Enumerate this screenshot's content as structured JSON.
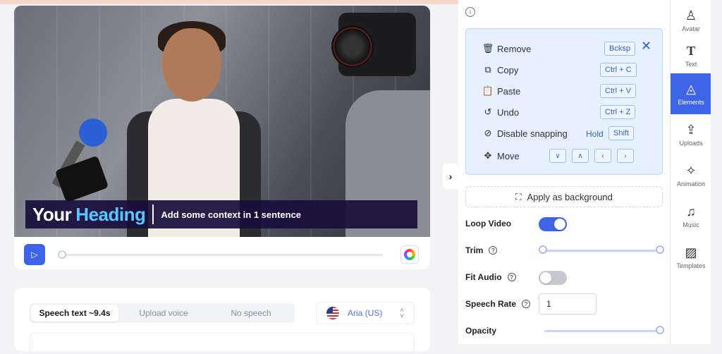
{
  "video": {
    "caption_first": "Your",
    "caption_second": "Heading",
    "caption_sub": "Add some context in 1 sentence"
  },
  "speech": {
    "tabs": [
      {
        "label": "Speech text ~9.4s",
        "active": true
      },
      {
        "label": "Upload voice",
        "active": false
      },
      {
        "label": "No speech",
        "active": false
      }
    ],
    "voice": "Aria (US)"
  },
  "shortcuts": {
    "remove": {
      "label": "Remove",
      "key": "Bcksp"
    },
    "copy": {
      "label": "Copy",
      "key": "Ctrl + C"
    },
    "paste": {
      "label": "Paste",
      "key": "Ctrl + V"
    },
    "undo": {
      "label": "Undo",
      "key": "Ctrl + Z"
    },
    "snapping": {
      "label": "Disable snapping",
      "hold": "Hold",
      "key": "Shift"
    },
    "move": {
      "label": "Move"
    }
  },
  "panel": {
    "apply_background": "Apply as background",
    "loop_video": {
      "label": "Loop Video",
      "on": true
    },
    "trim": {
      "label": "Trim"
    },
    "fit_audio": {
      "label": "Fit Audio",
      "on": false
    },
    "speech_rate": {
      "label": "Speech Rate",
      "value": "1"
    },
    "opacity": {
      "label": "Opacity",
      "value": 1
    }
  },
  "rail": [
    {
      "label": "Avatar",
      "icon": "avatar-icon"
    },
    {
      "label": "Text",
      "icon": "text-icon"
    },
    {
      "label": "Elements",
      "icon": "elements-icon",
      "active": true
    },
    {
      "label": "Uploads",
      "icon": "upload-icon"
    },
    {
      "label": "Animation",
      "icon": "animation-icon"
    },
    {
      "label": "Music",
      "icon": "music-icon"
    },
    {
      "label": "Templates",
      "icon": "templates-icon"
    }
  ],
  "colors": {
    "accent": "#3d63e6",
    "caption_bg": "#180e3c",
    "heading_blue": "#58c7ff"
  }
}
